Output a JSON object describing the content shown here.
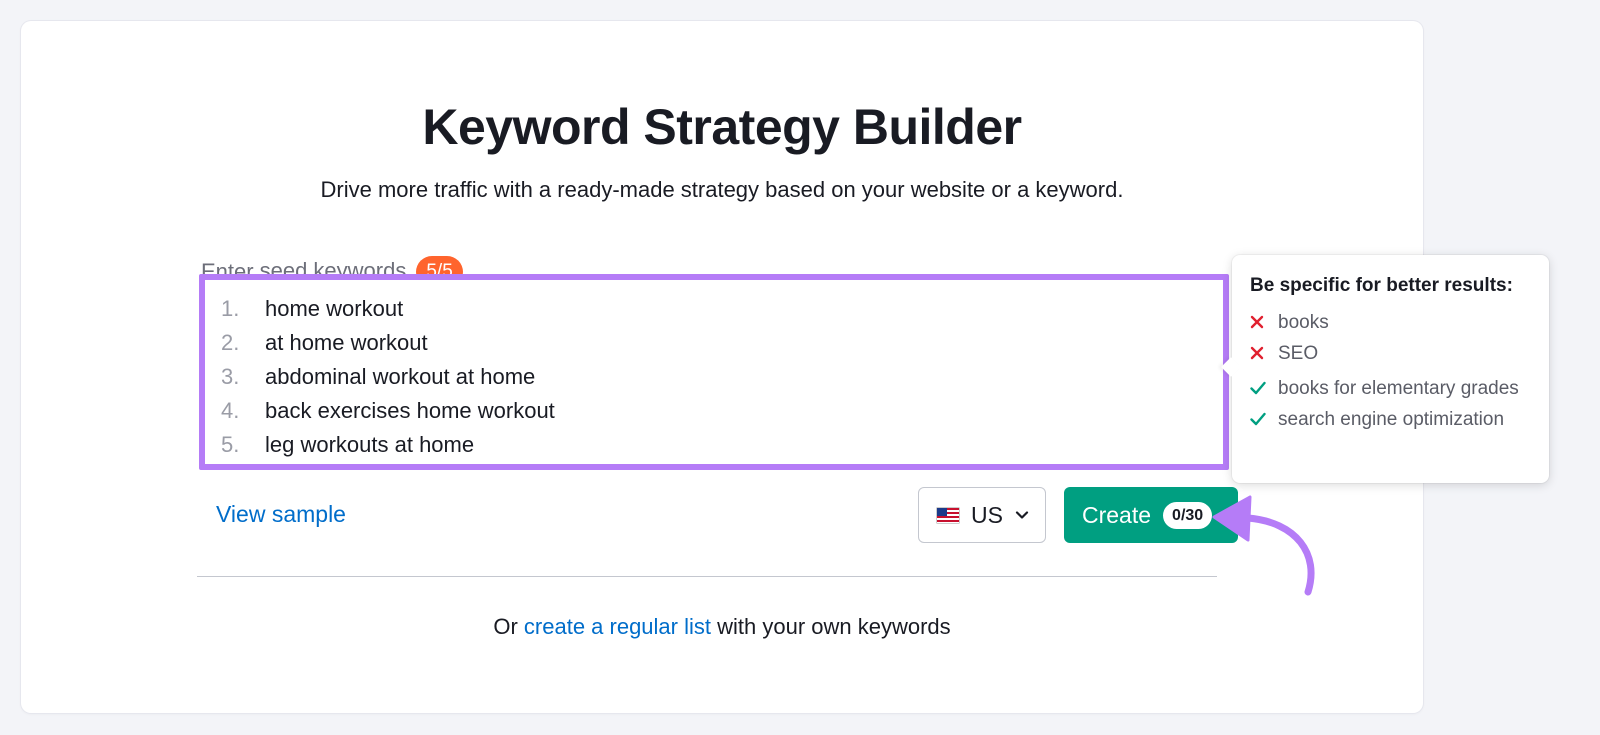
{
  "header": {
    "title": "Keyword Strategy Builder",
    "subtitle": "Drive more traffic with a ready-made strategy based on your website or a keyword."
  },
  "seed": {
    "label_prefix": "Enter",
    "label_link": "seed keywords",
    "count": "5/5",
    "count_color": "#ff642d",
    "highlight_color": "#b57cf7",
    "keywords": [
      {
        "num": "1.",
        "text": "home workout"
      },
      {
        "num": "2.",
        "text": "at home workout"
      },
      {
        "num": "3.",
        "text": "abdominal workout at home"
      },
      {
        "num": "4.",
        "text": "back exercises home workout"
      },
      {
        "num": "5.",
        "text": "leg workouts at home"
      }
    ]
  },
  "actions": {
    "view_sample": "View sample",
    "country": {
      "flag_icon": "us-flag-icon",
      "value": "US"
    },
    "create_label": "Create",
    "create_count": "0/30",
    "create_color": "#009f81"
  },
  "footer": {
    "prefix": "Or",
    "link": "create a regular list",
    "suffix": "with your own keywords"
  },
  "tooltip": {
    "title": "Be specific for better results:",
    "bad_examples": [
      "books",
      "SEO"
    ],
    "good_examples": [
      "books for elementary grades",
      "search engine optimization"
    ]
  }
}
